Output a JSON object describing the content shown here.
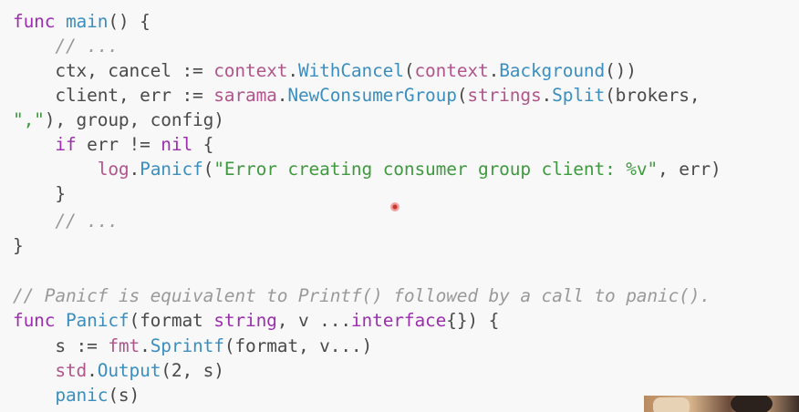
{
  "code": {
    "lines": [
      [
        {
          "t": "func ",
          "c": "kw"
        },
        {
          "t": "main",
          "c": "fn"
        },
        {
          "t": "() {",
          "c": "pl"
        }
      ],
      [
        {
          "t": "    // ...",
          "c": "cm"
        }
      ],
      [
        {
          "t": "    ctx, cancel := ",
          "c": "pl"
        },
        {
          "t": "context",
          "c": "pr"
        },
        {
          "t": ".",
          "c": "pl"
        },
        {
          "t": "WithCancel",
          "c": "fn"
        },
        {
          "t": "(",
          "c": "pl"
        },
        {
          "t": "context",
          "c": "pr"
        },
        {
          "t": ".",
          "c": "pl"
        },
        {
          "t": "Background",
          "c": "fn"
        },
        {
          "t": "())",
          "c": "pl"
        }
      ],
      [
        {
          "t": "    client, err := ",
          "c": "pl"
        },
        {
          "t": "sarama",
          "c": "pr"
        },
        {
          "t": ".",
          "c": "pl"
        },
        {
          "t": "NewConsumerGroup",
          "c": "fn"
        },
        {
          "t": "(",
          "c": "pl"
        },
        {
          "t": "strings",
          "c": "pr"
        },
        {
          "t": ".",
          "c": "pl"
        },
        {
          "t": "Split",
          "c": "fn"
        },
        {
          "t": "(brokers,",
          "c": "pl"
        }
      ],
      [
        {
          "t": "\",\"",
          "c": "str"
        },
        {
          "t": "), group, config)",
          "c": "pl"
        }
      ],
      [
        {
          "t": "    ",
          "c": "pl"
        },
        {
          "t": "if",
          "c": "kw"
        },
        {
          "t": " err != ",
          "c": "pl"
        },
        {
          "t": "nil",
          "c": "kw"
        },
        {
          "t": " {",
          "c": "pl"
        }
      ],
      [
        {
          "t": "        ",
          "c": "pl"
        },
        {
          "t": "log",
          "c": "pr"
        },
        {
          "t": ".",
          "c": "pl"
        },
        {
          "t": "Panicf",
          "c": "fn"
        },
        {
          "t": "(",
          "c": "pl"
        },
        {
          "t": "\"Error creating consumer group client: %v\"",
          "c": "str"
        },
        {
          "t": ", err)",
          "c": "pl"
        }
      ],
      [
        {
          "t": "    }",
          "c": "pl"
        }
      ],
      [
        {
          "t": "    // ...",
          "c": "cm"
        }
      ],
      [
        {
          "t": "}",
          "c": "pl"
        }
      ],
      [
        {
          "t": "",
          "c": "pl"
        }
      ],
      [
        {
          "t": "// Panicf is equivalent to Printf() followed by a call to panic().",
          "c": "cm"
        }
      ],
      [
        {
          "t": "func ",
          "c": "kw"
        },
        {
          "t": "Panicf",
          "c": "fn"
        },
        {
          "t": "(format ",
          "c": "pl"
        },
        {
          "t": "string",
          "c": "kw"
        },
        {
          "t": ", v ...",
          "c": "pl"
        },
        {
          "t": "interface",
          "c": "kw"
        },
        {
          "t": "{}) {",
          "c": "pl"
        }
      ],
      [
        {
          "t": "    s := ",
          "c": "pl"
        },
        {
          "t": "fmt",
          "c": "pr"
        },
        {
          "t": ".",
          "c": "pl"
        },
        {
          "t": "Sprintf",
          "c": "fn"
        },
        {
          "t": "(format, v...)",
          "c": "pl"
        }
      ],
      [
        {
          "t": "    ",
          "c": "pl"
        },
        {
          "t": "std",
          "c": "pr"
        },
        {
          "t": ".",
          "c": "pl"
        },
        {
          "t": "Output",
          "c": "fn"
        },
        {
          "t": "(2, s)",
          "c": "pl"
        }
      ],
      [
        {
          "t": "    ",
          "c": "pl"
        },
        {
          "t": "panic",
          "c": "fn"
        },
        {
          "t": "(s)",
          "c": "pl"
        }
      ]
    ]
  },
  "colors": {
    "keyword": "#9b2fae",
    "function": "#3b8fbf",
    "string": "#3f9a3f",
    "comment": "#9a9a9a",
    "plain": "#4a4a4a",
    "package": "#b0568c",
    "background": "#f8f8f8"
  }
}
